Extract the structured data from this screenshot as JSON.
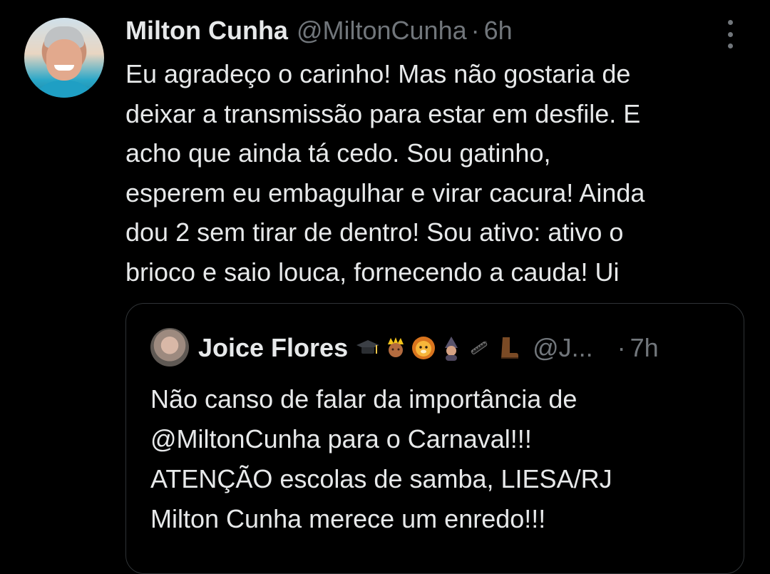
{
  "tweet": {
    "author_name": "Milton Cunha",
    "author_handle": "@MiltonCunha",
    "separator": "·",
    "time": "6h",
    "text": "Eu agradeço o carinho! Mas não gostaria de\ndeixar a transmissão para estar em desfile. E\nacho que ainda tá cedo. Sou gatinho,\nesperem eu embagulhar e virar cacura! Ainda\ndou 2 sem tirar de dentro! Sou ativo: ativo o\nbrioco e saio louca, fornecendo a cauda! Ui",
    "more_icon": "more-vertical-icon"
  },
  "quoted": {
    "author_name": "Joice Flores",
    "emojis": [
      "graduation-cap-emoji",
      "prince-emoji",
      "lion-face-emoji",
      "mage-emoji",
      "comb-emoji",
      "boot-emoji"
    ],
    "author_handle": "@J...",
    "separator": "·",
    "time": "7h",
    "text": "Não canso de falar da importância de\n@MiltonCunha  para o Carnaval!!!\nATENÇÃO escolas de samba, LIESA/RJ\nMilton Cunha merece um enredo!!!"
  },
  "colors": {
    "background": "#000000",
    "primary_text": "#e7e9ea",
    "secondary_text": "#71767b",
    "border": "#2f3336"
  }
}
